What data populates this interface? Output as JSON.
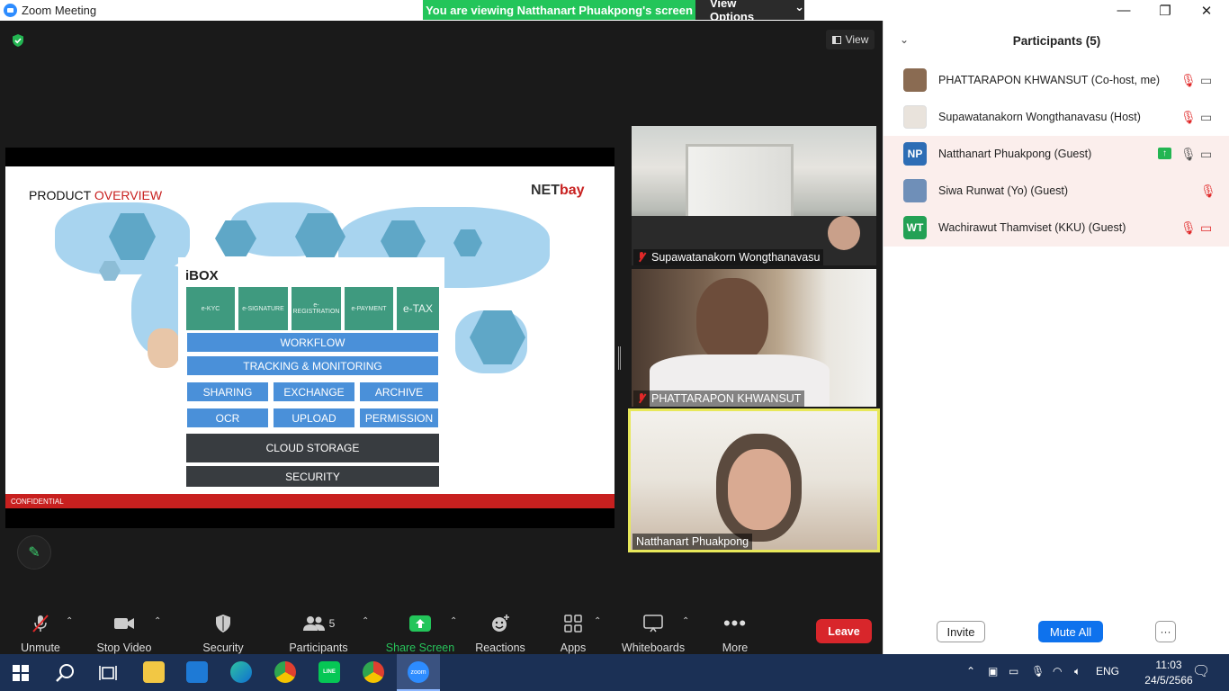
{
  "window": {
    "title": "Zoom Meeting",
    "minimize": "—",
    "restore": "❐",
    "close": "✕"
  },
  "share_banner": {
    "text": "You are viewing Natthanart Phuakpong's screen",
    "view_options": "View Options",
    "chevron": "⌄"
  },
  "view_button": "View",
  "slide": {
    "title_a": "PRODUCT ",
    "title_b": "OVERVIEW",
    "logo_a": "NET",
    "logo_b": "bay",
    "ibox_title": "iBOX",
    "modules": [
      "e-KYC",
      "e-SIGNATURE",
      "e-REGISTRATION",
      "e-PAYMENT",
      "e-TAX"
    ],
    "workflow": "WORKFLOW",
    "tracking": "TRACKING & MONITORING",
    "row1": [
      "SHARING",
      "EXCHANGE",
      "ARCHIVE"
    ],
    "row2": [
      "OCR",
      "UPLOAD",
      "PERMISSION"
    ],
    "cloud": "CLOUD STORAGE",
    "security": "SECURITY",
    "confidential": "CONFIDENTIAL"
  },
  "tiles": [
    {
      "name": "Supawatanakorn Wongthanavasu",
      "muted": true
    },
    {
      "name": "PHATTARAPON KHWANSUT",
      "muted": true
    },
    {
      "name": "Natthanart Phuakpong",
      "muted": false,
      "active_speaker": true
    }
  ],
  "toolbar": {
    "unmute": "Unmute",
    "stop_video": "Stop Video",
    "security": "Security",
    "participants": "Participants",
    "participants_count": "5",
    "share_screen": "Share Screen",
    "reactions": "Reactions",
    "apps": "Apps",
    "whiteboards": "Whiteboards",
    "more": "More",
    "leave": "Leave",
    "caret": "⌃"
  },
  "panel": {
    "title": "Participants (5)",
    "participants": [
      {
        "name": "PHATTARAPON KHWANSUT (Co-host, me)",
        "initials": "",
        "color": "#8a6b52"
      },
      {
        "name": "Supawatanakorn Wongthanavasu (Host)",
        "initials": "",
        "color": "#e9e3dc"
      },
      {
        "name": "Natthanart Phuakpong (Guest)",
        "initials": "NP",
        "color": "#2d6db5"
      },
      {
        "name": "Siwa Runwat (Yo) (Guest)",
        "initials": "",
        "color": "#6f8fb8"
      },
      {
        "name": "Wachirawut Thamviset (KKU) (Guest)",
        "initials": "WT",
        "color": "#23a155"
      }
    ],
    "invite": "Invite",
    "mute_all": "Mute All",
    "more": "···"
  },
  "taskbar": {
    "language": "ENG",
    "time": "11:03",
    "date": "24/5/2566",
    "zoom_label": "zoom",
    "line_label": "LINE"
  },
  "colors": {
    "share_green": "#23c55a",
    "leave_red": "#d8262b",
    "mute_red": "#e02828",
    "zoom_blue": "#2d8cff",
    "active_border": "#e8e85a"
  }
}
